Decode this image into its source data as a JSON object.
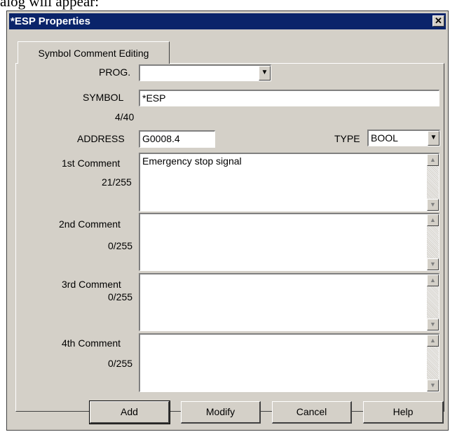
{
  "doc_fragment": "alog will appear:",
  "dialog": {
    "title": "*ESP Properties",
    "close_symbol": "✕",
    "tab_label": "Symbol Comment Editing"
  },
  "form": {
    "prog_label": "PROG.",
    "prog_value": "",
    "symbol_label": "SYMBOL",
    "symbol_value": "*ESP",
    "symbol_count": "4/40",
    "address_label": "ADDRESS",
    "address_value": "G0008.4",
    "type_label": "TYPE",
    "type_value": "BOOL",
    "comments": [
      {
        "label": "1st Comment",
        "count": "21/255",
        "value": "Emergency stop signal"
      },
      {
        "label": "2nd Comment",
        "count": "0/255",
        "value": ""
      },
      {
        "label": "3rd Comment",
        "count": "0/255",
        "value": ""
      },
      {
        "label": "4th Comment",
        "count": "0/255",
        "value": ""
      }
    ]
  },
  "buttons": {
    "add": "Add",
    "modify": "Modify",
    "cancel": "Cancel",
    "help": "Help"
  },
  "icons": {
    "dropdown": "chevron-down-icon",
    "scroll_up": "scroll-up-icon",
    "scroll_down": "scroll-down-icon",
    "close": "close-icon"
  },
  "colors": {
    "titlebar": "#0a246a",
    "dialog_bg": "#d4d0c8"
  }
}
